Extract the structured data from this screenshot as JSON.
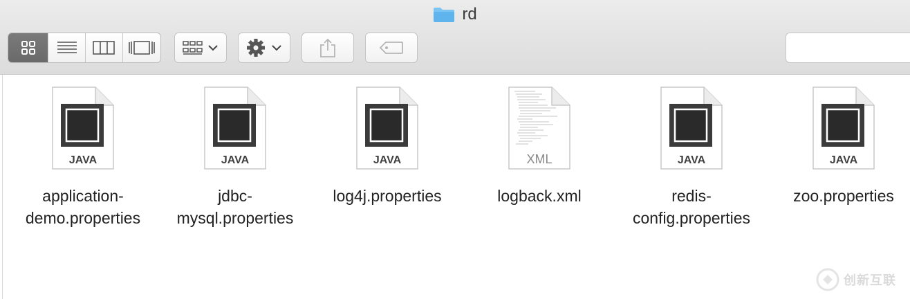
{
  "window": {
    "title": "rd"
  },
  "toolbar": {
    "view_modes": [
      "icon-view",
      "list-view",
      "column-view",
      "cover-flow-view"
    ],
    "active_view": "icon-view",
    "arrange_icon": "grid-arrange-icon",
    "action_icon": "gear-icon",
    "share_icon": "share-icon",
    "tag_icon": "tag-icon"
  },
  "files": [
    {
      "name": "application-demo.properties",
      "line1": "application-",
      "line2": "demo.properties",
      "type": "JAVA"
    },
    {
      "name": "jdbc-mysql.properties",
      "line1": "jdbc-",
      "line2": "mysql.properties",
      "type": "JAVA"
    },
    {
      "name": "log4j.properties",
      "line1": "log4j.properties",
      "line2": "",
      "type": "JAVA"
    },
    {
      "name": "logback.xml",
      "line1": "logback.xml",
      "line2": "",
      "type": "XML"
    },
    {
      "name": "redis-config.properties",
      "line1": "redis-",
      "line2": "config.properties",
      "type": "JAVA"
    },
    {
      "name": "zoo.properties",
      "line1": "zoo.properties",
      "line2": "",
      "type": "JAVA"
    }
  ],
  "watermark": {
    "text": "创新互联"
  },
  "colors": {
    "folder": "#5fb4ee",
    "active_segment": "#707070"
  }
}
